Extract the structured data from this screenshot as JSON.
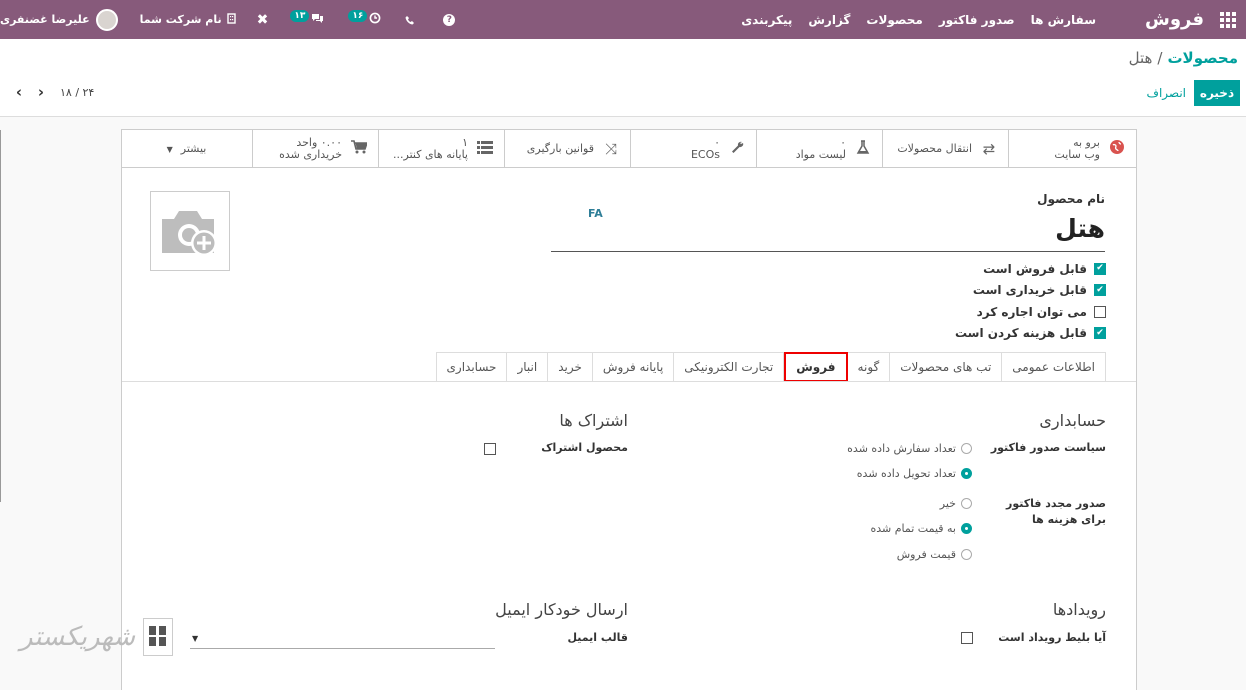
{
  "navbar": {
    "brand": "فروش",
    "menu": [
      "سفارش ها",
      "صدور فاکتور",
      "محصولات",
      "گزارش",
      "پیکربندی"
    ],
    "company": "نام شرکت شما",
    "user": "علیرضا غضنفری",
    "messages_badge": "۱۳",
    "activities_badge": "۱۶",
    "help_glyph": "?"
  },
  "breadcrumb": {
    "parent": "محصولات",
    "separator": "/",
    "current": "هتل"
  },
  "actions": {
    "save": "ذخیره",
    "discard": "انصراف"
  },
  "pager": {
    "value": "۱۸ / ۲۴",
    "prev": "‹",
    "next": "›"
  },
  "smart_buttons": {
    "website": {
      "line1": "برو به",
      "line2": "وب سایت",
      "icon": "globe-icon"
    },
    "moves": {
      "label": "انتقال محصولات",
      "icon": "exchange-icon"
    },
    "bom": {
      "num": "۰",
      "label": "لیست مواد",
      "icon": "flask-icon"
    },
    "ecos": {
      "num": "۰",
      "label": "ECOs",
      "icon": "wrench-icon"
    },
    "putaway": {
      "label": "قوانین بارگیری",
      "icon": "random-icon"
    },
    "pos": {
      "num": "۱",
      "label": "پایانه های کنتر...",
      "icon": "list-icon"
    },
    "purchased": {
      "num": "۰.۰۰ واحد",
      "label": "خریداری شده",
      "icon": "cart-icon"
    },
    "more": "بیشتر"
  },
  "product": {
    "name_label": "نام محصول",
    "lang": "FA",
    "name": "هتل",
    "checks": [
      {
        "label": "قابل فروش است",
        "checked": true
      },
      {
        "label": "قابل خریداری است",
        "checked": true
      },
      {
        "label": "می توان اجاره کرد",
        "checked": false
      },
      {
        "label": "قابل هزینه کردن است",
        "checked": true
      }
    ]
  },
  "tabs": [
    "اطلاعات عمومی",
    "تب های محصولات",
    "گونه",
    "فروش",
    "تجارت الکترونیکی",
    "پایانه فروش",
    "خرید",
    "انبار",
    "حسابداری"
  ],
  "active_tab": "فروش",
  "sales": {
    "accounting_title": "حسابداری",
    "invoice_policy_label": "سیاست صدور فاکتور",
    "invoice_options": [
      {
        "label": "تعداد سفارش داده شده",
        "selected": false
      },
      {
        "label": "تعداد تحویل داده شده",
        "selected": true
      }
    ],
    "reinvoice_label": "صدور مجدد فاکتور برای هزینه ها",
    "reinvoice_options": [
      {
        "label": "خیر",
        "selected": false
      },
      {
        "label": "به قیمت تمام شده",
        "selected": true
      },
      {
        "label": "قیمت فروش",
        "selected": false
      }
    ],
    "subscriptions_title": "اشتراک ها",
    "subscription_product_label": "محصول اشتراک",
    "events_title": "رویدادها",
    "event_ticket_label": "آیا بلیط رویداد است",
    "email_title": "ارسال خودکار ایمیل",
    "email_template_label": "قالب ایمیل"
  },
  "watermark": "شهریکستر",
  "colors": {
    "navbar": "#875a7b",
    "primary": "#00a09d",
    "highlight": "#e00000"
  }
}
